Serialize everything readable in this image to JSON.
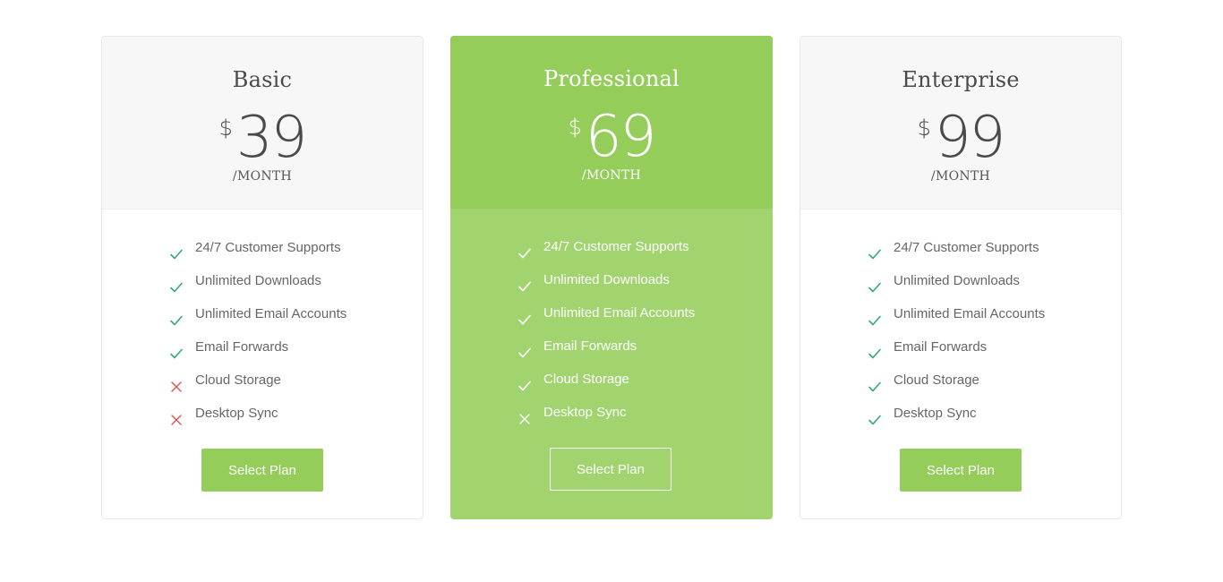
{
  "colors": {
    "accent": "#94cd5a",
    "accent_light": "#a1d46e",
    "check_green": "#3aa57a",
    "cross_red": "#d9534f",
    "text": "#666666"
  },
  "plans": [
    {
      "name": "Basic",
      "currency": "$",
      "amount": "39",
      "period": "/MONTH",
      "features": [
        {
          "label": "24/7 Customer Supports",
          "included": true
        },
        {
          "label": "Unlimited Downloads",
          "included": true
        },
        {
          "label": "Unlimited Email Accounts",
          "included": true
        },
        {
          "label": "Email Forwards",
          "included": true
        },
        {
          "label": "Cloud Storage",
          "included": false
        },
        {
          "label": "Desktop Sync",
          "included": false
        }
      ],
      "button_label": "Select Plan"
    },
    {
      "name": "Professional",
      "currency": "$",
      "amount": "69",
      "period": "/MONTH",
      "features": [
        {
          "label": "24/7 Customer Supports",
          "included": true
        },
        {
          "label": "Unlimited Downloads",
          "included": true
        },
        {
          "label": "Unlimited Email Accounts",
          "included": true
        },
        {
          "label": "Email Forwards",
          "included": true
        },
        {
          "label": "Cloud Storage",
          "included": true
        },
        {
          "label": "Desktop Sync",
          "included": false
        }
      ],
      "button_label": "Select Plan"
    },
    {
      "name": "Enterprise",
      "currency": "$",
      "amount": "99",
      "period": "/MONTH",
      "features": [
        {
          "label": "24/7 Customer Supports",
          "included": true
        },
        {
          "label": "Unlimited Downloads",
          "included": true
        },
        {
          "label": "Unlimited Email Accounts",
          "included": true
        },
        {
          "label": "Email Forwards",
          "included": true
        },
        {
          "label": "Cloud Storage",
          "included": true
        },
        {
          "label": "Desktop Sync",
          "included": true
        }
      ],
      "button_label": "Select Plan"
    }
  ]
}
